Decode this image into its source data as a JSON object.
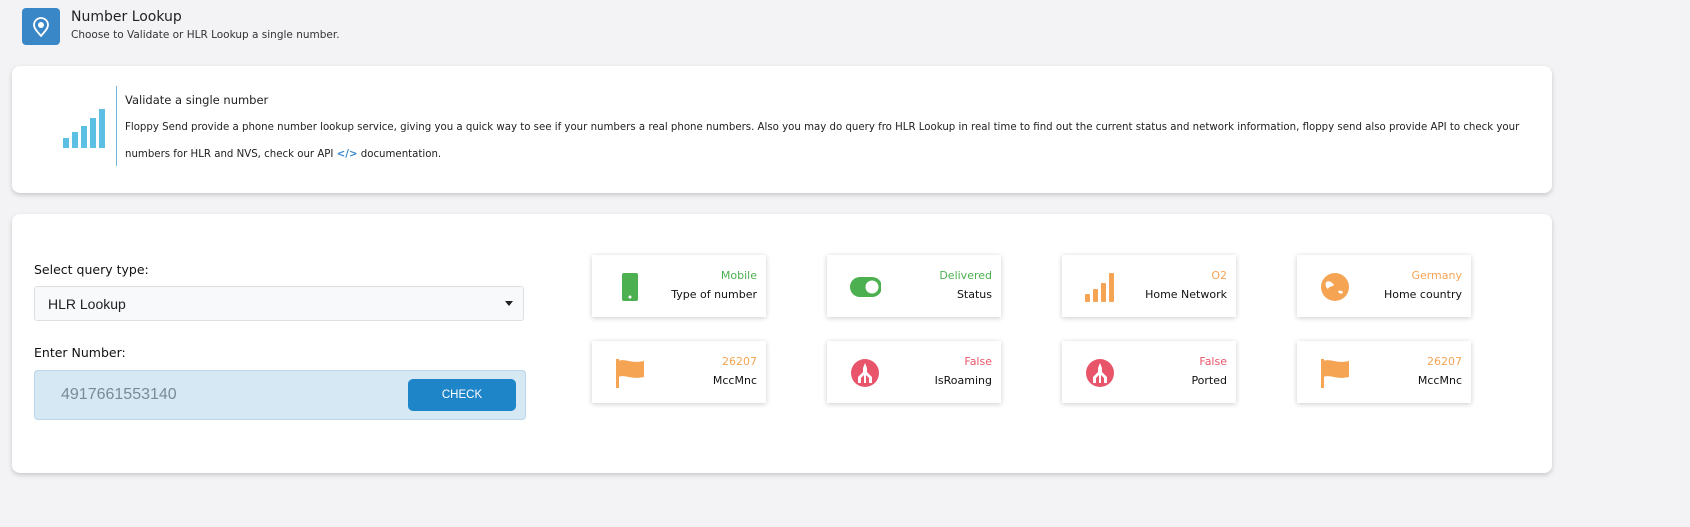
{
  "header": {
    "title": "Number Lookup",
    "subtitle": "Choose to Validate or HLR Lookup a single number.",
    "icon": "phone-location-icon"
  },
  "info": {
    "title": "Validate a single number",
    "text_before": "Floppy Send provide a phone number lookup service, giving you a quick way to see if your numbers a real phone numbers. Also you may do query fro HLR Lookup in real time to find out the current status and network information, floppy send also provide API to check your numbers for HLR and NVS, check our API",
    "api_icon": "code-icon",
    "text_after": "documentation."
  },
  "form": {
    "query_label": "Select query type:",
    "query_value": "HLR Lookup",
    "number_label": "Enter Number:",
    "number_value": "4917661553140",
    "check_label": "CHECK"
  },
  "colors": {
    "green": "#28a745",
    "orange": "#f5a454",
    "red": "#e8556a",
    "blue": "#1f85c9"
  },
  "stats": [
    {
      "value": "Mobile",
      "label": "Type of number",
      "icon": "mobile-phone-icon",
      "color": "#4caf50"
    },
    {
      "value": "Delivered",
      "label": "Status",
      "icon": "toggle-on-icon",
      "color": "#4caf50"
    },
    {
      "value": "O2",
      "label": "Home Network",
      "icon": "signal-icon",
      "color": "#f5a454"
    },
    {
      "value": "Germany",
      "label": "Home country",
      "icon": "globe-icon",
      "color": "#f5a454"
    },
    {
      "value": "26207",
      "label": "MccMnc",
      "icon": "flag-icon",
      "color": "#f5a454"
    },
    {
      "value": "False",
      "label": "IsRoaming",
      "icon": "roaming-icon",
      "color": "#e8556a"
    },
    {
      "value": "False",
      "label": "Ported",
      "icon": "ported-icon",
      "color": "#e8556a"
    },
    {
      "value": "26207",
      "label": "MccMnc",
      "icon": "flag-icon",
      "color": "#f5a454"
    }
  ]
}
